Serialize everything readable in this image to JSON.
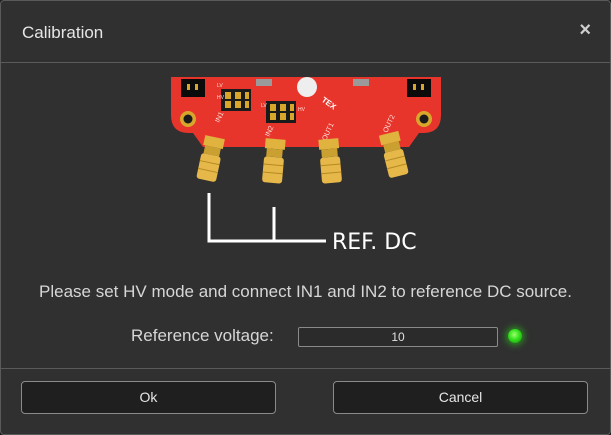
{
  "dialog": {
    "title": "Calibration",
    "close_symbol": "×"
  },
  "illustration": {
    "board_logo": "TEX",
    "ports": [
      "IN1",
      "IN2",
      "OUT1",
      "OUT2"
    ],
    "jumper_labels": [
      "LV",
      "HV",
      "LV",
      "HV"
    ],
    "ref_label": "REF. DC",
    "board_color": "#e8352b",
    "connector_color": "#d9a62c"
  },
  "instruction": "Please set HV mode and connect IN1 and IN2 to reference DC source.",
  "reference": {
    "label": "Reference voltage:",
    "value": "10",
    "status_color": "#34e11d"
  },
  "buttons": {
    "ok": "Ok",
    "cancel": "Cancel"
  }
}
